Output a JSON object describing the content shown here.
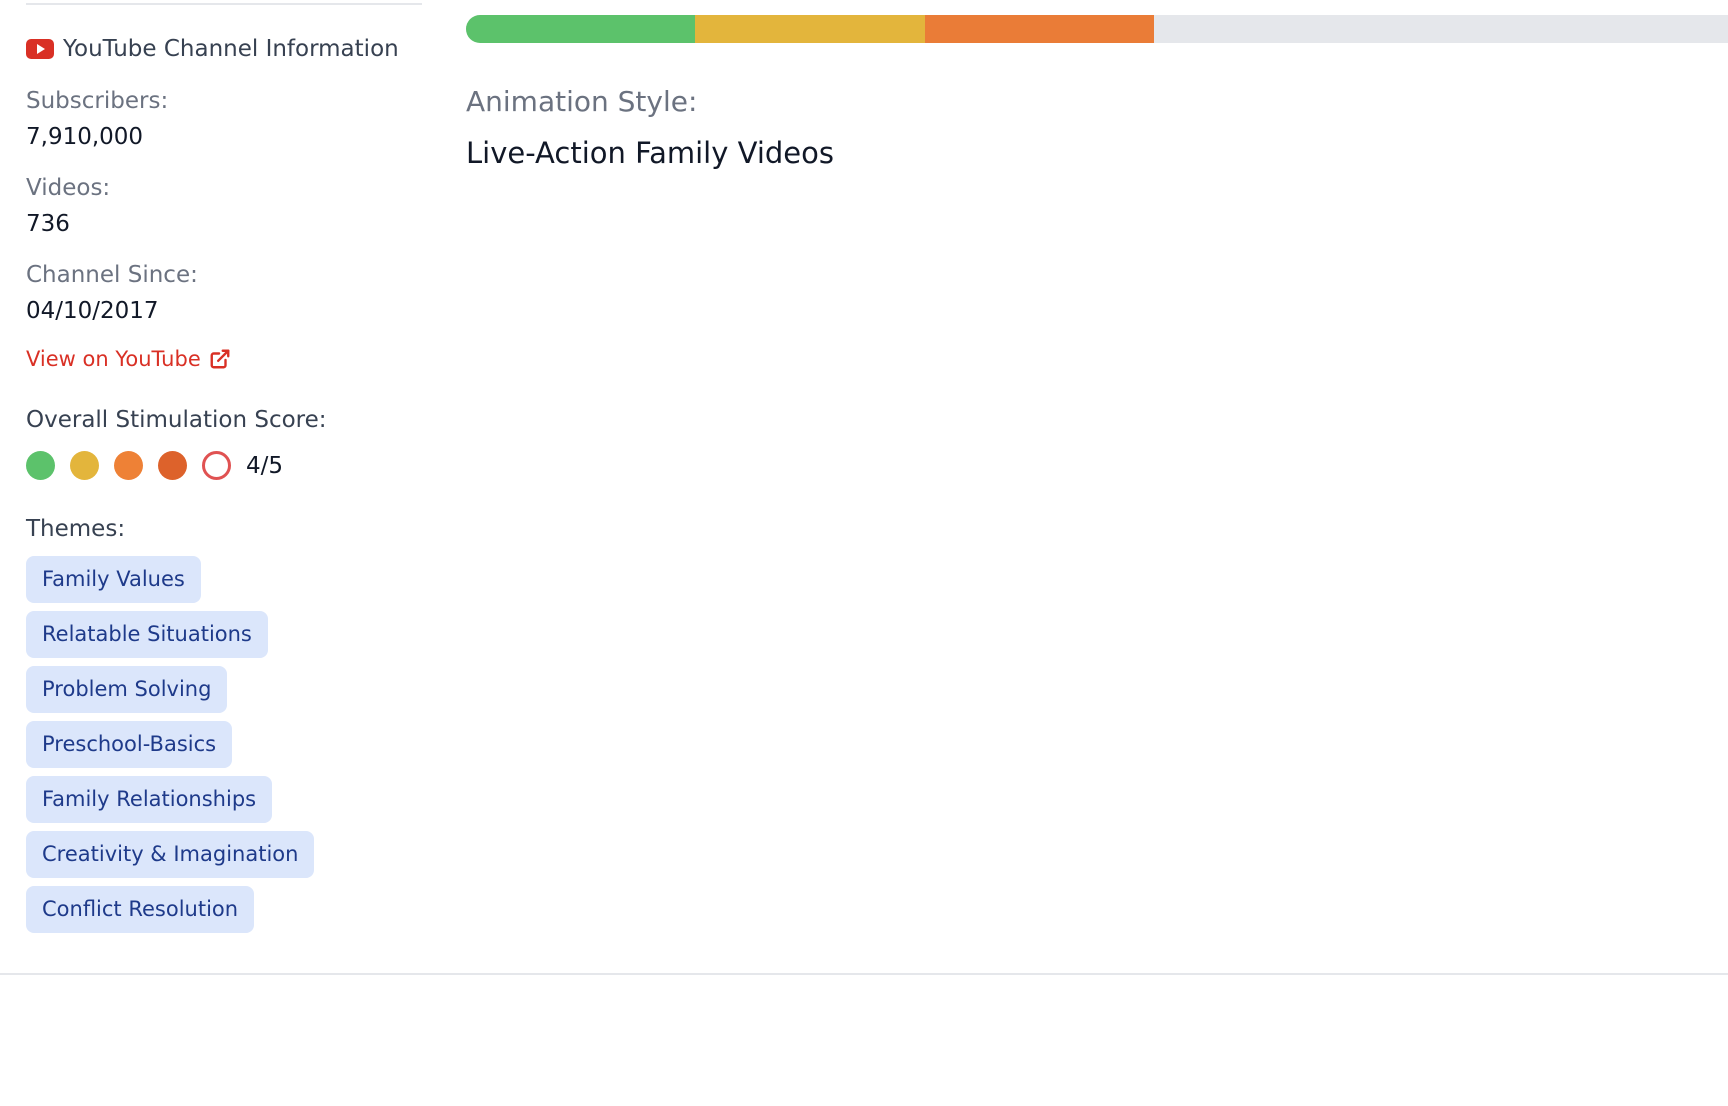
{
  "channel_info": {
    "title": "YouTube Channel Information",
    "subscribers_label": "Subscribers:",
    "subscribers_value": "7,910,000",
    "videos_label": "Videos:",
    "videos_value": "736",
    "since_label": "Channel Since:",
    "since_value": "04/10/2017",
    "link_label": "View on YouTube",
    "icon": "youtube-icon",
    "link_icon": "external-link-icon"
  },
  "stimulation": {
    "label": "Overall Stimulation Score:",
    "score_text": "4/5",
    "score": 4,
    "max": 5,
    "dot_colors": [
      "#5cc26b",
      "#e3b53c",
      "#ee8136",
      "#dd622b"
    ],
    "empty_dot_color": "#e05252"
  },
  "themes": {
    "label": "Themes:",
    "items": [
      "Family Values",
      "Relatable Situations",
      "Problem Solving",
      "Preschool-Basics",
      "Family Relationships",
      "Creativity & Imagination",
      "Conflict Resolution"
    ]
  },
  "stimulation_bar": {
    "filled_fraction": 0.545,
    "segment_colors": [
      "#5cc26b",
      "#e3b53c",
      "#ea7c37"
    ],
    "track_color": "#e5e7eb"
  },
  "animation": {
    "label": "Animation Style:",
    "value": "Live-Action Family Videos"
  },
  "colors": {
    "link": "#d93025",
    "tag_bg": "#dbe6fb",
    "tag_text": "#1e3a8a"
  }
}
